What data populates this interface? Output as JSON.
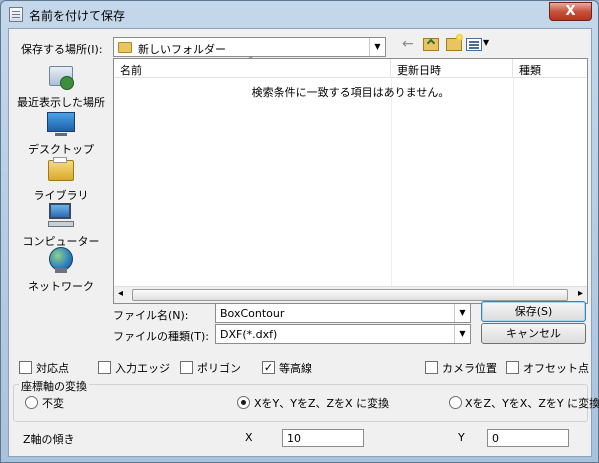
{
  "window": {
    "title": "名前を付けて保存",
    "close": "X"
  },
  "save_in": {
    "label": "保存する場所(I):",
    "value": "新しいフォルダー"
  },
  "sidebar": [
    {
      "label": "最近表示した場所"
    },
    {
      "label": "デスクトップ"
    },
    {
      "label": "ライブラリ"
    },
    {
      "label": "コンピューター"
    },
    {
      "label": "ネットワーク"
    }
  ],
  "list": {
    "headers": [
      "名前",
      "更新日時",
      "種類"
    ],
    "empty_message": "検索条件に一致する項目はありません。"
  },
  "filename": {
    "label": "ファイル名(N):",
    "value": "BoxContour"
  },
  "filetype": {
    "label": "ファイルの種類(T):",
    "value": "DXF(*.dxf)"
  },
  "buttons": {
    "save": "保存(S)",
    "cancel": "キャンセル"
  },
  "options": [
    {
      "label": "対応点",
      "checked": false
    },
    {
      "label": "入力エッジ",
      "checked": false
    },
    {
      "label": "ポリゴン",
      "checked": false
    },
    {
      "label": "等高線",
      "checked": true
    },
    {
      "label": "カメラ位置",
      "checked": false
    },
    {
      "label": "オフセット点",
      "checked": false
    }
  ],
  "axis_transform": {
    "title": "座標軸の変換",
    "choices": [
      {
        "label": "不変",
        "selected": false
      },
      {
        "label": "XをY、YをZ、ZをX に変換",
        "selected": true
      },
      {
        "label": "XをZ、YをX、ZをY に変換",
        "selected": false
      }
    ]
  },
  "z_tilt": {
    "label": "Z軸の傾き",
    "x_label": "X",
    "x_value": "10",
    "y_label": "Y",
    "y_value": "0"
  },
  "glyphs": {
    "check": "✓",
    "dropdown": "▼",
    "sort_up": "^",
    "back": "←",
    "scroll_left": "◂",
    "scroll_right": "▸"
  }
}
